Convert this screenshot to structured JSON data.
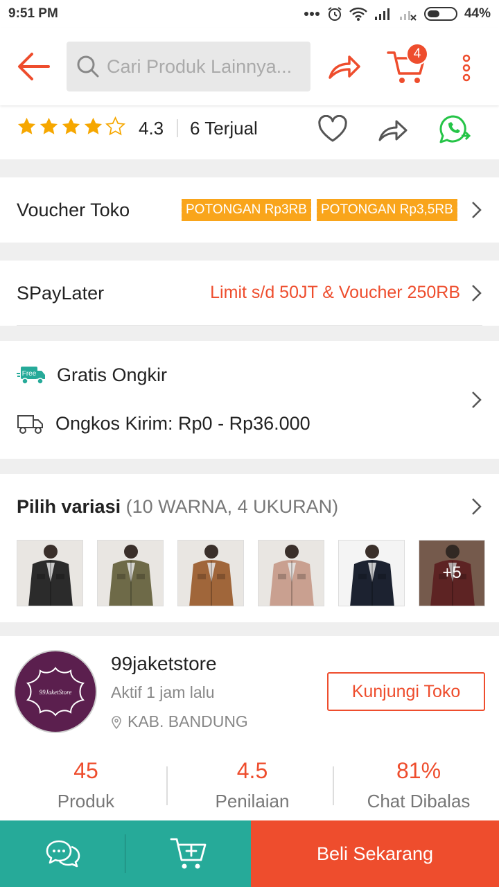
{
  "status_bar": {
    "time": "9:51 PM",
    "battery": "44%",
    "battery_level": 0.44
  },
  "header": {
    "search_placeholder": "Cari Produk Lainnya...",
    "cart_count": "4"
  },
  "rating_row": {
    "rating": "4.3",
    "stars": 4,
    "sold": "6 Terjual"
  },
  "voucher": {
    "label": "Voucher Toko",
    "tags": [
      "POTONGAN Rp3RB",
      "POTONGAN Rp3,5RB"
    ]
  },
  "paylater": {
    "label": "SPayLater",
    "promo": "Limit s/d 50JT & Voucher 250RB"
  },
  "shipping": {
    "free_badge": "Free",
    "free_label": "Gratis Ongkir",
    "cost_label": "Ongkos Kirim: Rp0 - Rp36.000"
  },
  "variation": {
    "title": "Pilih variasi",
    "count": "(10 WARNA, 4 UKURAN)",
    "more": "+5",
    "thumb_colors": [
      "#2b2b2b",
      "#6e6a48",
      "#a0663a",
      "#c9a090",
      "#1c2230",
      "#6e2a2a"
    ]
  },
  "shop": {
    "name": "99jaketstore",
    "logo_text": "99JaketStore",
    "active": "Aktif 1 jam lalu",
    "location": "KAB. BANDUNG",
    "visit_label": "Kunjungi Toko",
    "stats": [
      {
        "num": "45",
        "label": "Produk"
      },
      {
        "num": "4.5",
        "label": "Penilaian"
      },
      {
        "num": "81%",
        "label": "Chat Dibalas"
      }
    ]
  },
  "bottom_bar": {
    "buy_label": "Beli Sekarang"
  },
  "colors": {
    "accent": "#ee4d2d",
    "teal": "#26aa99",
    "star": "#f6a700",
    "voucher": "#f9a51b",
    "whatsapp": "#25c447"
  }
}
